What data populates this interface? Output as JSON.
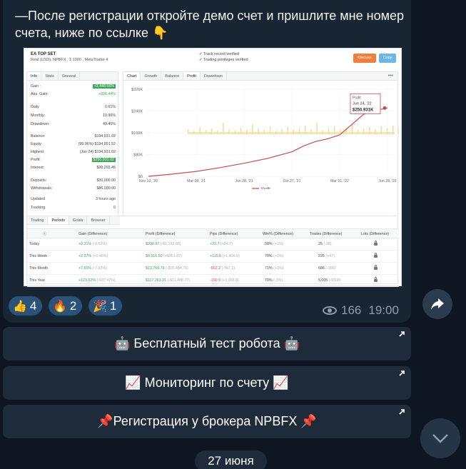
{
  "message": {
    "text": "—После регистрации откройте демо счет и пришлите мне номер счета, ниже по ссылке 👇"
  },
  "screenshot": {
    "title": "EA TOP SET",
    "subtitle": "Real (USD), NPBFX , 1:1000 , MetaTrader 4",
    "verified1": "Track record verified",
    "verified2": "Trading privileges verified",
    "discuss": "Discuss",
    "copy": "Copy",
    "left_tabs": [
      "Info",
      "Stats",
      "General"
    ],
    "stats": [
      {
        "label": "Gain :",
        "value": "+3,448.66%",
        "style": "gbg"
      },
      {
        "label": "Abs. Gain:",
        "value": "+836.44%",
        "style": "green"
      },
      {
        "label": "Daily",
        "value": "0.61%",
        "style": ""
      },
      {
        "label": "Monthly:",
        "value": "19.96%",
        "style": ""
      },
      {
        "label": "Drawdown:",
        "value": "49.46%",
        "style": ""
      },
      {
        "label": "Balance:",
        "value": "$194,931.02",
        "style": ""
      },
      {
        "label": "Equity:",
        "value": "(99.96%) $194,851.52",
        "style": ""
      },
      {
        "label": "Highest:",
        "value": "(Jun 24) $194,931.02",
        "style": ""
      },
      {
        "label": "Profit:",
        "value": "$250,931.02",
        "style": "gbg"
      },
      {
        "label": "Interest:",
        "value": "$20,202.45",
        "style": ""
      },
      {
        "label": "Deposits:",
        "value": "$30,000.00",
        "style": ""
      },
      {
        "label": "Withdrawals:",
        "value": "$86,000.00",
        "style": ""
      },
      {
        "label": "Updated",
        "value": "3 hours ago",
        "style": ""
      },
      {
        "label": "Tracking",
        "value": "0",
        "style": ""
      }
    ],
    "chart_tabs": [
      "Chart",
      "Growth",
      "Balance",
      "Profit",
      "Drawdown"
    ],
    "chart_more": "•••",
    "bottom_tabs": [
      "Trading",
      "Periods",
      "Goals",
      "Browser"
    ],
    "table_headers": [
      "Gain (Difference)",
      "Profit (Difference)",
      "Pips (Difference)",
      "Win% (Difference)",
      "Trades (Difference)",
      "Lots (Difference)"
    ],
    "table_info_icon": "ⓘ",
    "table_rows": [
      {
        "period": "Today",
        "gain": "+0.31%",
        "gain_d": "(-0.62%)",
        "profit": "$398.97",
        "profit_d": "(-$1,193.88)",
        "pips": "+33.7",
        "pips_d": "(+84.7)",
        "pips_neg": false,
        "win": "58%",
        "win_d": "(+2%)",
        "trades": "25",
        "trades_d": "(-38)"
      },
      {
        "period": "This Week",
        "gain": "+2.37%",
        "gain_d": "(+0.46%)",
        "profit": "$4,516.50",
        "profit_d": "(+$951.87)",
        "pips": "+115.6",
        "pips_d": "(+1,406.9)",
        "pips_neg": false,
        "win": "70%",
        "win_d": "(+1%)",
        "trades": "225",
        "trades_d": "(+47)"
      },
      {
        "period": "This Month",
        "gain": "+7.60%",
        "gain_d": "(-7.93%)",
        "profit": "$13,769.79",
        "profit_d": "(-$10,484.76)",
        "pips": "-862.2",
        "pips_d": "(-967.1)",
        "pips_neg": true,
        "win": "71%",
        "win_d": "(+1%)",
        "trades": "686",
        "trades_d": "(-396)"
      },
      {
        "period": "This Year",
        "gain": "+123.62%",
        "gain_d": "(-937.47%)",
        "profit": "$117,263.31",
        "profit_d": "(-$11,488.77)",
        "pips": "-190.9",
        "pips_d": "(+1,093.8)",
        "pips_neg": true,
        "win": "70%",
        "win_d": "(-3%)",
        "trades": "5,005",
        "trades_d": "(-5508)"
      }
    ]
  },
  "chart_data": {
    "type": "area",
    "title": "",
    "xlabel": "",
    "ylabel": "",
    "x_ticks": [
      "Nov 13, '20",
      "Mar 08, '21",
      "Jun 28, '21",
      "Oct 27, '21",
      "Mar 01, '22",
      "Jun 28, '22"
    ],
    "y_ticks": [
      "$320K",
      "$240K",
      "$160K",
      "$80K",
      "$0"
    ],
    "ylim": [
      0,
      320000
    ],
    "legend": "Profit",
    "legend_position": "bottom",
    "tooltip": {
      "title": "Profit",
      "date": "Jun 24, '22",
      "value": "$250.931K"
    },
    "series": [
      {
        "name": "Profit",
        "color": "#c0504d",
        "x": [
          0,
          0.1,
          0.2,
          0.3,
          0.4,
          0.5,
          0.6,
          0.65,
          0.7,
          0.75,
          0.8,
          0.85,
          0.9,
          0.95,
          1.0
        ],
        "values": [
          0,
          8000,
          18000,
          32000,
          48000,
          66000,
          90000,
          112000,
          128000,
          138000,
          152000,
          190000,
          228000,
          242000,
          250931
        ]
      },
      {
        "name": "Volume",
        "color": "#f3d98a",
        "note_values": "bars"
      }
    ]
  },
  "reactions": [
    {
      "emoji": "👍",
      "count": "4"
    },
    {
      "emoji": "🔥",
      "count": "2"
    },
    {
      "emoji": "🎉",
      "count": "1"
    }
  ],
  "views": "166",
  "time": "19:00",
  "buttons": [
    {
      "label": "🤖 Бесплатный тест робота 🤖"
    },
    {
      "label": "📈 Мониторинг по счету 📈"
    },
    {
      "label": "📌Регистрация у брокера NPBFX 📌"
    }
  ],
  "date_chip": "27 июня",
  "colors": {
    "bg": "#0e1621",
    "bubble": "#182533",
    "reaction": "#2b5278",
    "button": "#1d2b3a"
  }
}
